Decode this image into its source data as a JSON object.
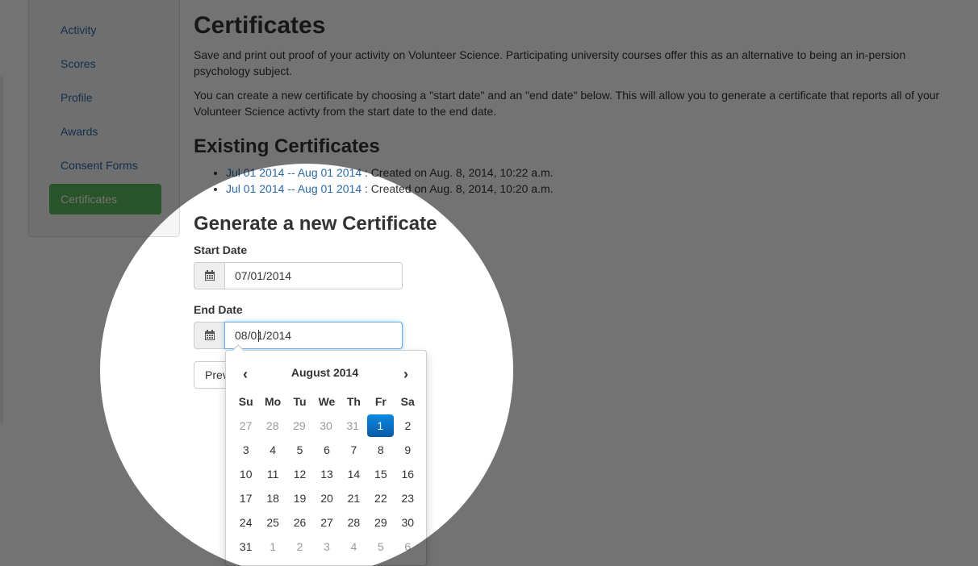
{
  "sidebar": {
    "items": [
      {
        "label": "Activity",
        "active": false
      },
      {
        "label": "Scores",
        "active": false
      },
      {
        "label": "Profile",
        "active": false
      },
      {
        "label": "Awards",
        "active": false
      },
      {
        "label": "Consent Forms",
        "active": false
      },
      {
        "label": "Certificates",
        "active": true
      }
    ]
  },
  "main": {
    "title": "Certificates",
    "intro1": "Save and print out proof of your activity on Volunteer Science. Participating university courses offer this as an alternative to being an in-persion psychology subject.",
    "intro2": "You can create a new certificate by choosing a \"start date\" and an \"end date\" below. This will allow you to generate a certificate that reports all of your Volunteer Science activty from the start date to the end date.",
    "existing_heading": "Existing Certificates",
    "certificates": [
      {
        "range": "Jul 01 2014 -- Aug 01 2014",
        "created": " : Created on Aug. 8, 2014, 10:22 a.m."
      },
      {
        "range": "Jul 01 2014 -- Aug 01 2014",
        "created": " : Created on Aug. 8, 2014, 10:20 a.m."
      }
    ],
    "generate_heading": "Generate a new Certificate",
    "start_label": "Start Date",
    "start_value": "07/01/2014",
    "end_label": "End Date",
    "end_value": "08/01/2014",
    "preview_button": "Preview"
  },
  "datepicker": {
    "month_title": "August 2014",
    "prev": "‹",
    "next": "›",
    "weekdays": [
      "Su",
      "Mo",
      "Tu",
      "We",
      "Th",
      "Fr",
      "Sa"
    ],
    "weeks": [
      [
        {
          "d": "27",
          "t": "old"
        },
        {
          "d": "28",
          "t": "old"
        },
        {
          "d": "29",
          "t": "old"
        },
        {
          "d": "30",
          "t": "old"
        },
        {
          "d": "31",
          "t": "old"
        },
        {
          "d": "1",
          "t": "active"
        },
        {
          "d": "2",
          "t": ""
        }
      ],
      [
        {
          "d": "3",
          "t": ""
        },
        {
          "d": "4",
          "t": ""
        },
        {
          "d": "5",
          "t": ""
        },
        {
          "d": "6",
          "t": ""
        },
        {
          "d": "7",
          "t": ""
        },
        {
          "d": "8",
          "t": ""
        },
        {
          "d": "9",
          "t": ""
        }
      ],
      [
        {
          "d": "10",
          "t": ""
        },
        {
          "d": "11",
          "t": ""
        },
        {
          "d": "12",
          "t": ""
        },
        {
          "d": "13",
          "t": ""
        },
        {
          "d": "14",
          "t": ""
        },
        {
          "d": "15",
          "t": ""
        },
        {
          "d": "16",
          "t": ""
        }
      ],
      [
        {
          "d": "17",
          "t": ""
        },
        {
          "d": "18",
          "t": ""
        },
        {
          "d": "19",
          "t": ""
        },
        {
          "d": "20",
          "t": ""
        },
        {
          "d": "21",
          "t": ""
        },
        {
          "d": "22",
          "t": ""
        },
        {
          "d": "23",
          "t": ""
        }
      ],
      [
        {
          "d": "24",
          "t": ""
        },
        {
          "d": "25",
          "t": ""
        },
        {
          "d": "26",
          "t": ""
        },
        {
          "d": "27",
          "t": ""
        },
        {
          "d": "28",
          "t": ""
        },
        {
          "d": "29",
          "t": ""
        },
        {
          "d": "30",
          "t": ""
        }
      ],
      [
        {
          "d": "31",
          "t": ""
        },
        {
          "d": "1",
          "t": "new"
        },
        {
          "d": "2",
          "t": "new"
        },
        {
          "d": "3",
          "t": "new"
        },
        {
          "d": "4",
          "t": "new"
        },
        {
          "d": "5",
          "t": "new"
        },
        {
          "d": "6",
          "t": "new"
        }
      ]
    ]
  },
  "colors": {
    "link": "#2a6aa8",
    "active_nav": "#5cb85c",
    "selected_day": "#0b6dc2",
    "overlay": "rgba(0,0,0,0.55)"
  }
}
